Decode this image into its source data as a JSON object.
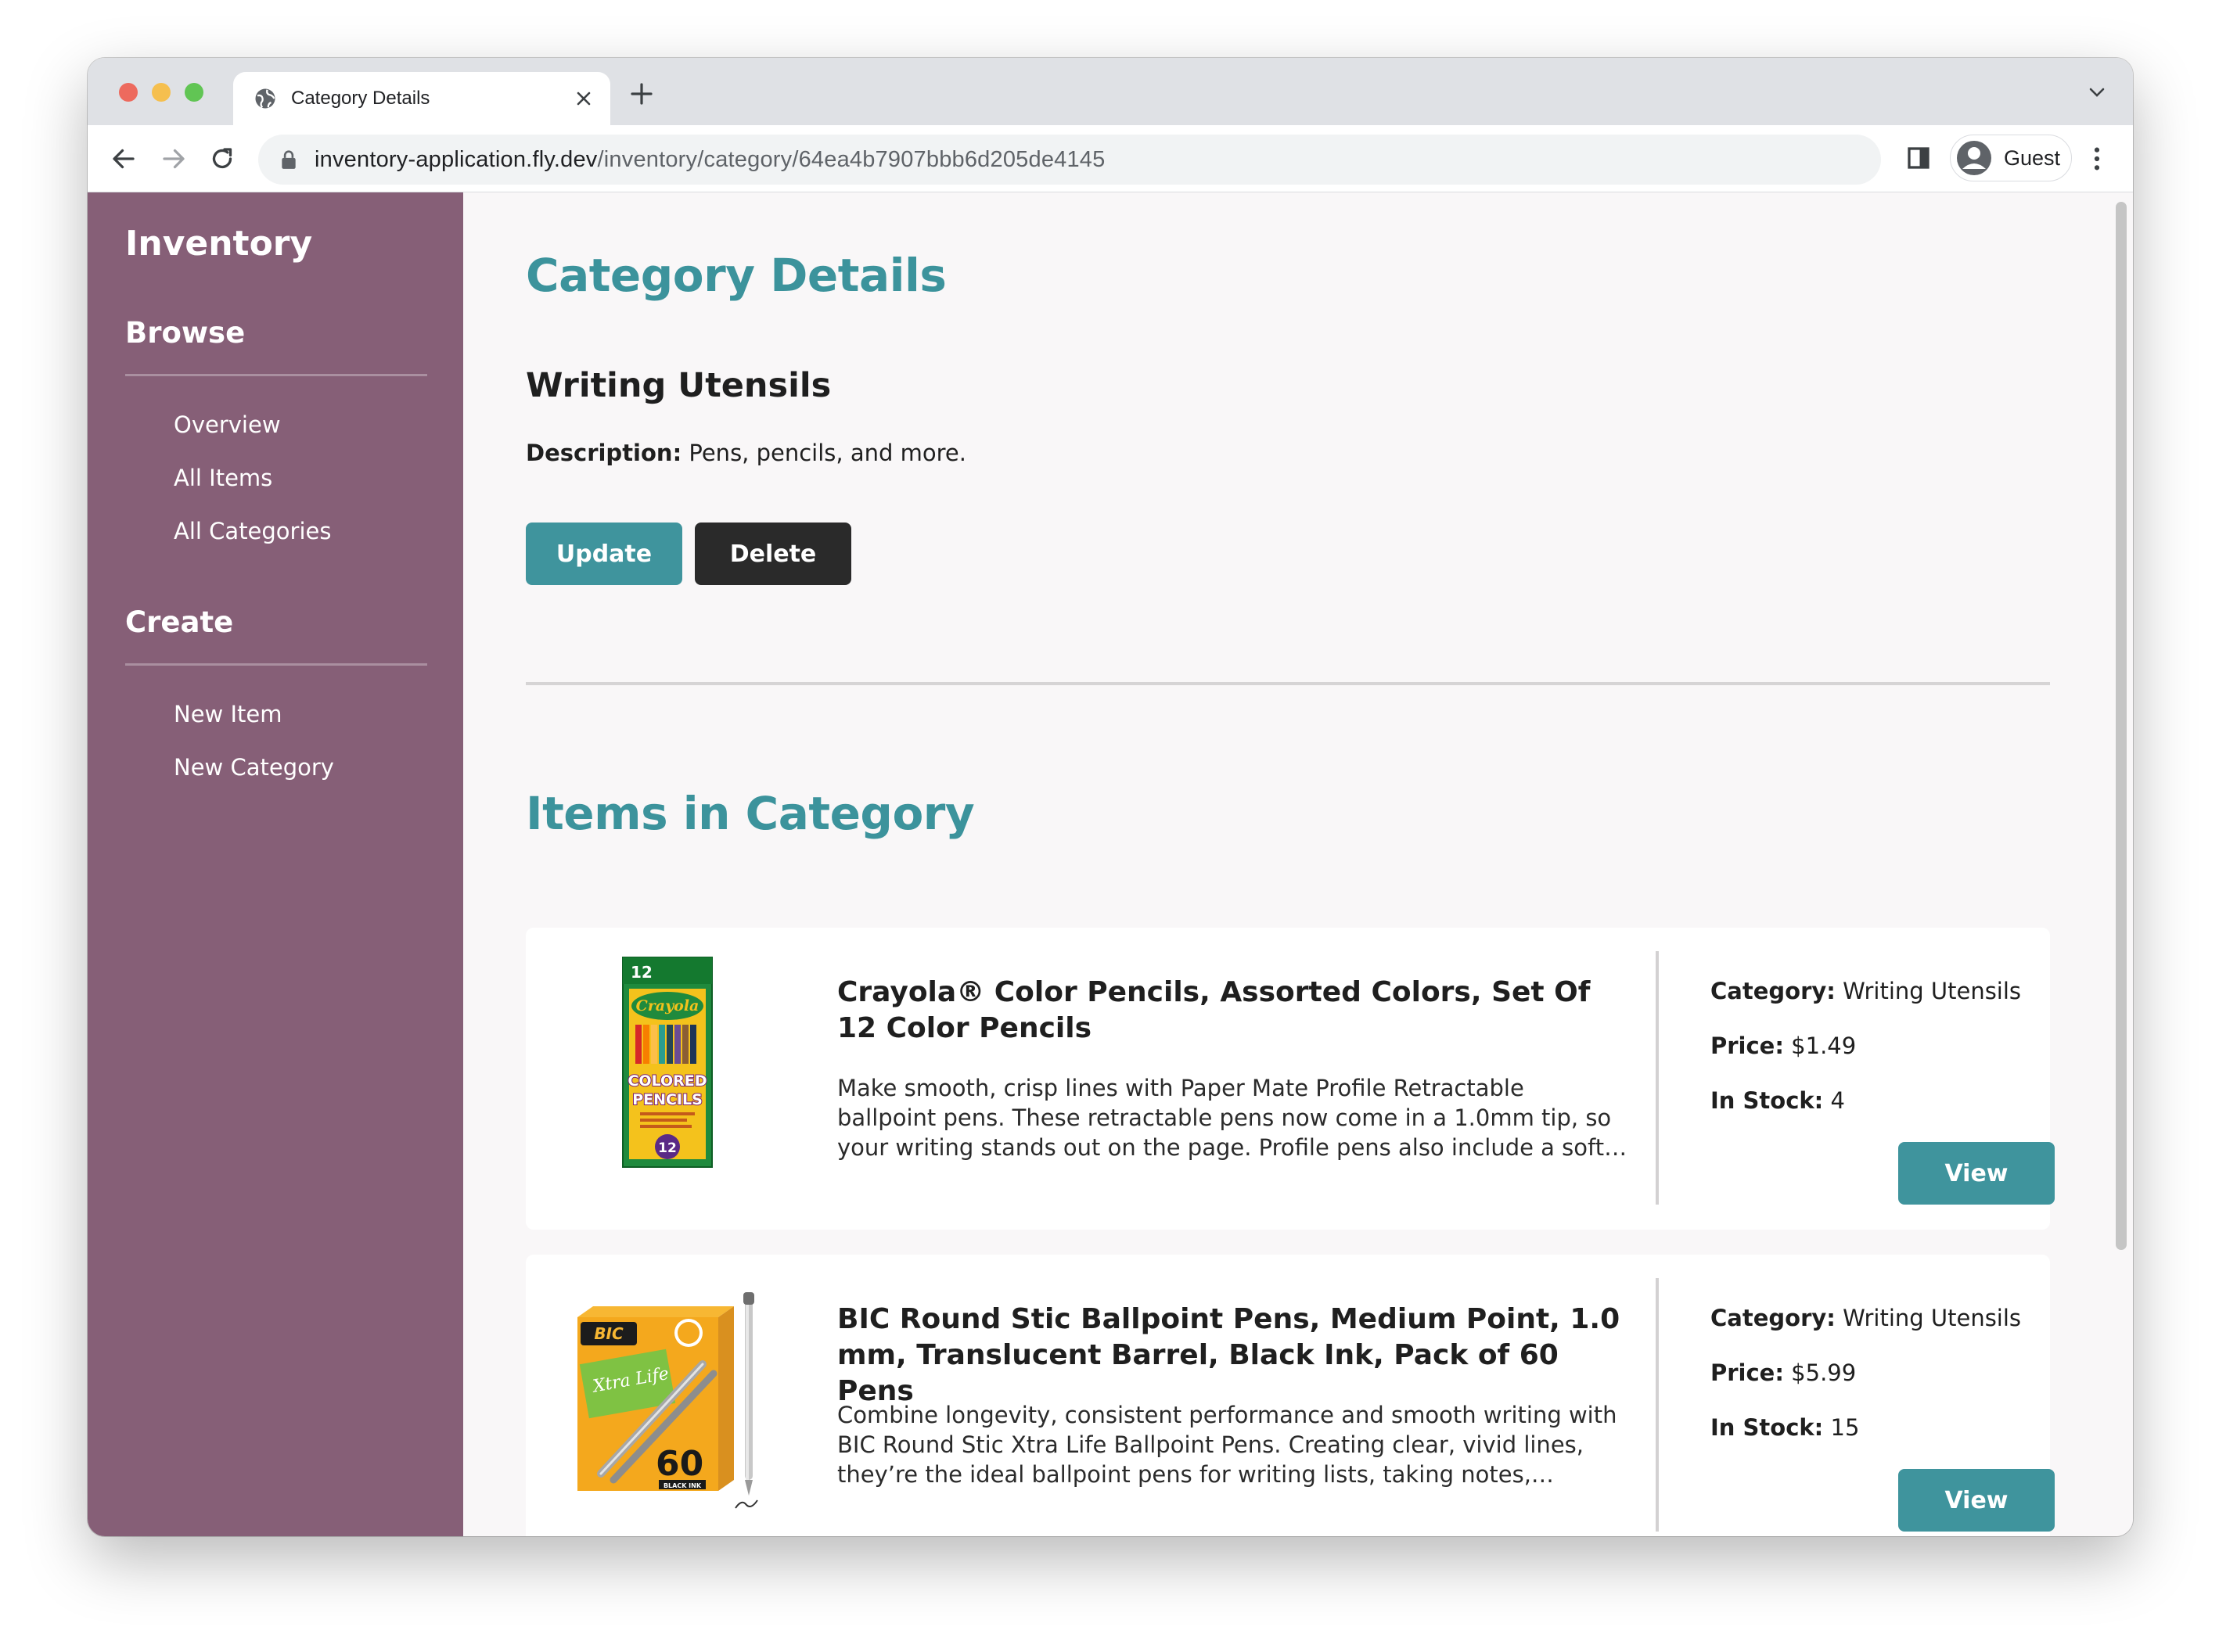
{
  "browser": {
    "tab_title": "Category Details",
    "url_host": "inventory-application.fly.dev",
    "url_path": "/inventory/category/64ea4b7907bbb6d205de4145",
    "profile_label": "Guest"
  },
  "sidebar": {
    "brand": "Inventory",
    "browse_heading": "Browse",
    "browse_links": [
      "Overview",
      "All Items",
      "All Categories"
    ],
    "create_heading": "Create",
    "create_links": [
      "New Item",
      "New Category"
    ]
  },
  "main": {
    "heading": "Category Details",
    "category_name": "Writing Utensils",
    "description_label": "Description:",
    "description_value": " Pens, pencils, and more.",
    "update_label": "Update",
    "delete_label": "Delete",
    "items_heading": "Items in Category",
    "items": [
      {
        "title": "Crayola® Color Pencils, Assorted Colors, Set Of 12 Color Pencils",
        "blurb": "Make smooth, crisp lines with Paper Mate Profile Retractable ballpoint pens. These retractable pens now come in a 1.0mm tip, so your writing stands out on the page. Profile pens also include a soft…",
        "category_label": "Category:",
        "category_value": " Writing Utensils",
        "price_label": "Price:",
        "price_value": " $1.49",
        "stock_label": "In Stock:",
        "stock_value": " 4",
        "view_label": "View"
      },
      {
        "title": "BIC Round Stic Ballpoint Pens, Medium Point, 1.0 mm, Translucent Barrel, Black Ink, Pack of 60 Pens",
        "blurb": "Combine longevity, consistent performance and smooth writing with BIC Round Stic Xtra Life Ballpoint Pens. Creating clear, vivid lines, they’re the ideal ballpoint pens for writing lists, taking notes,…",
        "category_label": "Category:",
        "category_value": " Writing Utensils",
        "price_label": "Price:",
        "price_value": " $5.99",
        "stock_label": "In Stock:",
        "stock_value": " 15",
        "view_label": "View"
      }
    ]
  },
  "product_art": {
    "crayola_top_number": "12",
    "crayola_brand": "Crayola",
    "crayola_word1": "COLORED",
    "crayola_word2": "PENCILS",
    "crayola_badge": "12",
    "bic_brand": "BIC",
    "bic_line": "Xtra Life",
    "bic_count": "60",
    "bic_ink": "BLACK INK"
  },
  "colors": {
    "sidebar_bg": "#865f77",
    "accent_teal": "#3c939c",
    "delete_bg": "#2a2a2a"
  }
}
